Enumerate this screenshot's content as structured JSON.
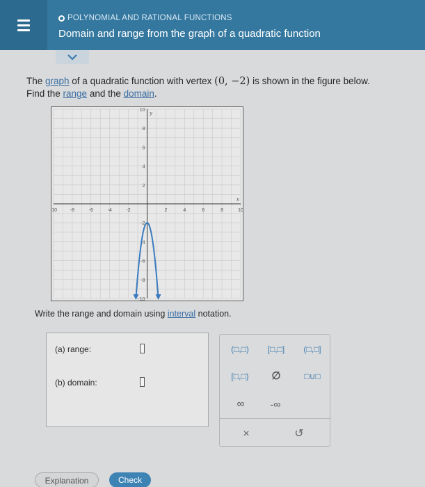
{
  "header": {
    "section": "POLYNOMIAL AND RATIONAL FUNCTIONS",
    "title": "Domain and range from the graph of a quadratic function"
  },
  "question": {
    "p1": "The ",
    "link_graph": "graph",
    "p2": " of a quadratic function with vertex ",
    "vertex": "(0, −2)",
    "p3": " is shown in the figure below.",
    "p4": "Find the ",
    "link_range": "range",
    "p5": " and the ",
    "link_domain": "domain",
    "p6": "."
  },
  "graph": {
    "x_ticks": [
      "-10",
      "-8",
      "-6",
      "-4",
      "-2",
      "2",
      "4",
      "6",
      "8",
      "10"
    ],
    "y_ticks": [
      "10",
      "8",
      "6",
      "4",
      "2",
      "-2",
      "-4",
      "-6",
      "-8",
      "-10"
    ],
    "x_label": "x",
    "y_label": "y",
    "vertex": [
      0,
      -2
    ],
    "xlim": [
      -10,
      10
    ],
    "ylim": [
      -10,
      10
    ],
    "curve_color": "#3a7bbf"
  },
  "instructions": {
    "p1": "Write the range and domain using ",
    "link": "interval",
    "p2": " notation."
  },
  "answer": {
    "range_label": "(a)  range:",
    "domain_label": "(b)  domain:"
  },
  "keypad": {
    "open_open": "(□,□)",
    "closed_closed": "[□,□]",
    "open_closed": "(□,□]",
    "closed_open": "[□,□)",
    "empty_set": "∅",
    "union": "□∪□",
    "infinity": "∞",
    "neg_infinity": "-∞",
    "clear": "×",
    "undo": "↺"
  },
  "buttons": {
    "explanation": "Explanation",
    "check": "Check"
  },
  "colors": {
    "header_bg": "#35789f",
    "accent": "#3a7bbf"
  }
}
